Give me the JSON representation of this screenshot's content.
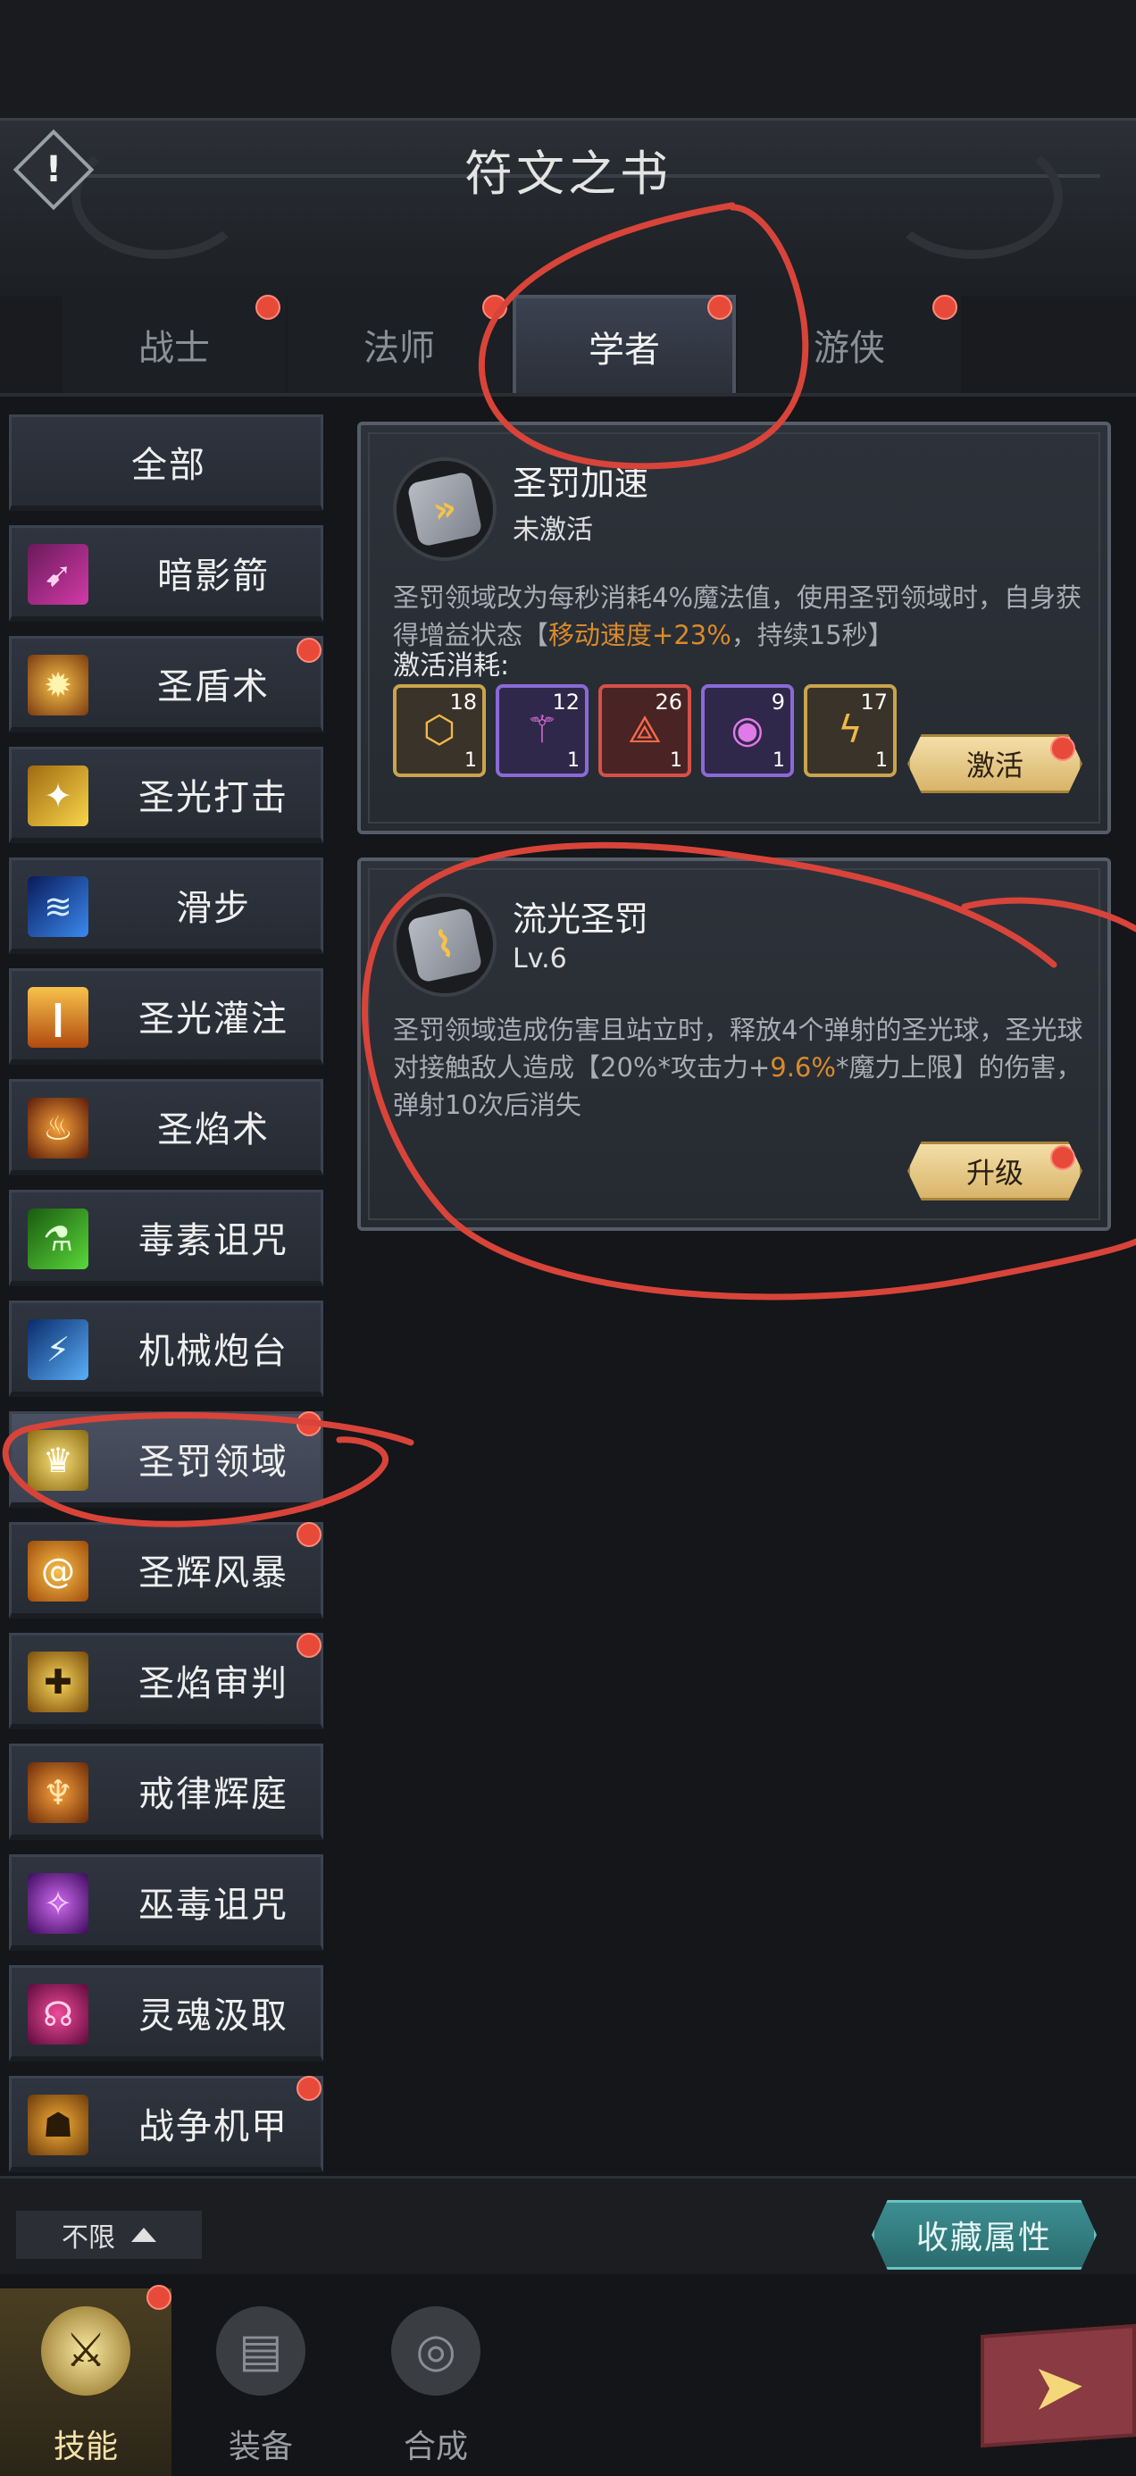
{
  "header": {
    "title": "符文之书",
    "info_icon": "exclamation-icon"
  },
  "class_tabs": [
    {
      "label": "战士",
      "active": false,
      "dot": true
    },
    {
      "label": "法师",
      "active": false,
      "dot": true
    },
    {
      "label": "学者",
      "active": true,
      "dot": true
    },
    {
      "label": "游侠",
      "active": false,
      "dot": true
    }
  ],
  "sidebar": {
    "items": [
      {
        "label": "全部",
        "icon": "",
        "dot": false,
        "selected": false
      },
      {
        "label": "暗影箭",
        "icon": "shadow-arrow-icon",
        "dot": false,
        "selected": false
      },
      {
        "label": "圣盾术",
        "icon": "holy-shield-icon",
        "dot": true,
        "selected": false
      },
      {
        "label": "圣光打击",
        "icon": "holy-strike-icon",
        "dot": false,
        "selected": false
      },
      {
        "label": "滑步",
        "icon": "slide-step-icon",
        "dot": false,
        "selected": false
      },
      {
        "label": "圣光灌注",
        "icon": "holy-infusion-icon",
        "dot": false,
        "selected": false
      },
      {
        "label": "圣焰术",
        "icon": "holy-flame-icon",
        "dot": false,
        "selected": false
      },
      {
        "label": "毒素诅咒",
        "icon": "poison-curse-icon",
        "dot": false,
        "selected": false
      },
      {
        "label": "机械炮台",
        "icon": "mech-turret-icon",
        "dot": false,
        "selected": false
      },
      {
        "label": "圣罚领域",
        "icon": "holy-punish-field-icon",
        "dot": true,
        "selected": true
      },
      {
        "label": "圣辉风暴",
        "icon": "holy-storm-icon",
        "dot": true,
        "selected": false
      },
      {
        "label": "圣焰审判",
        "icon": "holy-judgement-icon",
        "dot": true,
        "selected": false
      },
      {
        "label": "戒律辉庭",
        "icon": "discipline-court-icon",
        "dot": false,
        "selected": false
      },
      {
        "label": "巫毒诅咒",
        "icon": "voodoo-curse-icon",
        "dot": false,
        "selected": false
      },
      {
        "label": "灵魂汲取",
        "icon": "soul-drain-icon",
        "dot": false,
        "selected": false
      },
      {
        "label": "战争机甲",
        "icon": "war-mech-icon",
        "dot": true,
        "selected": false
      }
    ]
  },
  "runes": [
    {
      "name": "圣罚加速",
      "status": "未激活",
      "desc_before": "圣罚领域改为每秒消耗4%魔法值，使用圣罚领域时，自身获得增益状态【",
      "desc_highlight": "移动速度+23%",
      "desc_after": "，持续15秒】",
      "cost_label": "激活消耗:",
      "materials": [
        {
          "num": "18",
          "count": "1",
          "icon": "gold-rune-material-icon",
          "border": "#c9a44e",
          "bg": "#3a3329"
        },
        {
          "num": "12",
          "count": "1",
          "icon": "purple-wand-material-icon",
          "border": "#8a6ad6",
          "bg": "#30284a"
        },
        {
          "num": "26",
          "count": "1",
          "icon": "red-triangle-material-icon",
          "border": "#d6504a",
          "bg": "#4a2424"
        },
        {
          "num": "9",
          "count": "1",
          "icon": "purple-eye-material-icon",
          "border": "#8a6ad6",
          "bg": "#30284a"
        },
        {
          "num": "17",
          "count": "1",
          "icon": "gold-lightning-material-icon",
          "border": "#c9a44e",
          "bg": "#3a3329"
        }
      ],
      "button": "激活"
    },
    {
      "name": "流光圣罚",
      "status": "Lv.6",
      "desc_before": "圣罚领域造成伤害且站立时，释放4个弹射的圣光球，圣光球对接触敌人造成【20%*攻击力+",
      "desc_highlight": "9.6%",
      "desc_after": "*魔力上限】的伤害，弹射10次后消失",
      "button": "升级"
    }
  ],
  "footer": {
    "filter_label": "不限",
    "collect_button": "收藏属性"
  },
  "bottom_nav": [
    {
      "label": "技能",
      "icon": "sword-skill-icon",
      "active": true,
      "dot": true
    },
    {
      "label": "装备",
      "icon": "equipment-icon",
      "active": false,
      "dot": false
    },
    {
      "label": "合成",
      "icon": "synthesis-icon",
      "active": false,
      "dot": false
    }
  ],
  "next_icon": "arrow-right-icon",
  "colors": {
    "accent_gold": "#d98a2b",
    "dot_red": "#e84a3a",
    "annotation_red": "#d8443a",
    "teal_button": "#3d8f92"
  }
}
